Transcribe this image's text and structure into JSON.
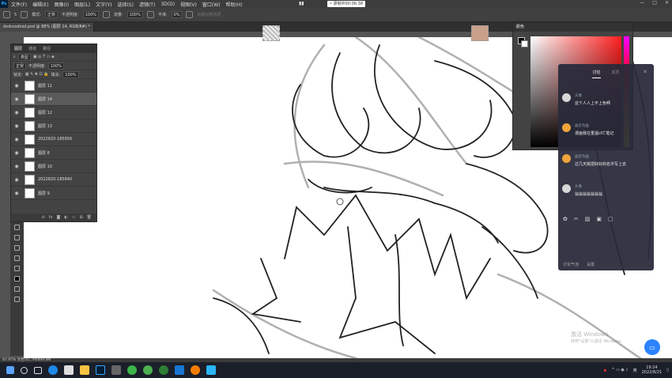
{
  "menubar": {
    "logo": "Ps",
    "items": [
      "文件(F)",
      "编辑(E)",
      "图像(I)",
      "图层(L)",
      "文字(Y)",
      "选择(S)",
      "滤镜(T)",
      "3D(D)",
      "视图(V)",
      "窗口(W)",
      "帮助(H)"
    ],
    "recording_label": "• 录制中00:06:38"
  },
  "options": {
    "mode_label": "模式:",
    "mode_value": "正常",
    "opacity_label": "不透明度:",
    "opacity_value": "100%",
    "flow_label": "流量:",
    "flow_value": "100%",
    "smooth_label": "平滑:",
    "smooth_value": "0%",
    "brush_size": "5",
    "extra_label": "绘图对称选项"
  },
  "document_tab": {
    "title": "dvdsvsdvsd.psd @ 88% (图层 14, RGB/8#) *"
  },
  "layers_panel": {
    "tabs": [
      "图层",
      "通道",
      "路径"
    ],
    "kind_label": "类型",
    "blend_mode": "正常",
    "opacity_label": "不透明度:",
    "opacity_value": "100%",
    "lock_label": "锁定:",
    "fill_label": "填充:",
    "fill_value": "100%",
    "layers": [
      {
        "name": "图层 11",
        "selected": false
      },
      {
        "name": "图层 14",
        "selected": true
      },
      {
        "name": "图层 12",
        "selected": false
      },
      {
        "name": "图层 13",
        "selected": false
      },
      {
        "name": "2022820-185656",
        "selected": false
      },
      {
        "name": "图层 8",
        "selected": false
      },
      {
        "name": "图层 10",
        "selected": false
      },
      {
        "name": "2022820-185840",
        "selected": false
      },
      {
        "name": "图层 9",
        "selected": false
      }
    ]
  },
  "color_panel": {
    "title": "颜色"
  },
  "chat": {
    "tab_discuss": "讨论",
    "tab_other": "成员",
    "messages": [
      {
        "name": "头像",
        "text": "这个人人上不上色啊"
      },
      {
        "name": "画云为画",
        "text": "漫画我在重温cf亡笔记"
      },
      {
        "name": "画云为画",
        "text": "过几天挑把好好的名字写上去"
      },
      {
        "name": "头像",
        "text": "翁翁翁翁翁翁翁"
      }
    ],
    "bottom_left": "讨论气泡",
    "bottom_right": "设置"
  },
  "statusbar": {
    "text": "87.97%     文档:41.7M/899.9M"
  },
  "watermark": {
    "line1": "激活 Windows",
    "line2": "转到\"设置\"以激活 Windows。"
  },
  "tray": {
    "ime": "英",
    "time": "19:24",
    "date": "2022/8/21"
  },
  "colors": {
    "accent": "#2c82ff",
    "taskbar": "#1b1f2a"
  }
}
